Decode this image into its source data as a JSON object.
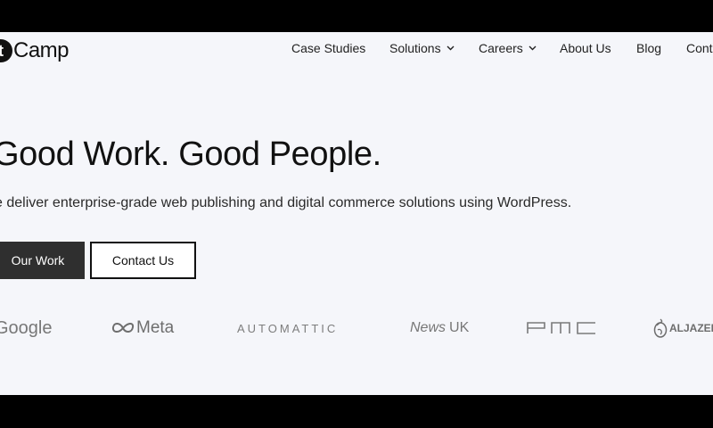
{
  "header": {
    "logo_text": "Camp",
    "logo_mark": "t",
    "nav": [
      {
        "label": "Case Studies",
        "dropdown": false
      },
      {
        "label": "Solutions",
        "dropdown": true
      },
      {
        "label": "Careers",
        "dropdown": true
      },
      {
        "label": "About Us",
        "dropdown": false
      },
      {
        "label": "Blog",
        "dropdown": false
      },
      {
        "label": "Cont",
        "dropdown": false
      }
    ]
  },
  "hero": {
    "title": "Good Work. Good People.",
    "subtitle": "e deliver enterprise-grade web publishing and digital commerce solutions using WordPress.",
    "primary_button": "Our Work",
    "secondary_button": "Contact Us"
  },
  "client_logos": [
    "Google",
    "Meta",
    "AUTOMATTIC",
    "News",
    "UK",
    "PMC",
    "ALJAZEE"
  ],
  "colors": {
    "page_bg": "#f5f6fa",
    "frame": "#000000",
    "text": "#111111",
    "primary_button_bg": "#2f2f2f",
    "logo_gray": "#777777"
  }
}
